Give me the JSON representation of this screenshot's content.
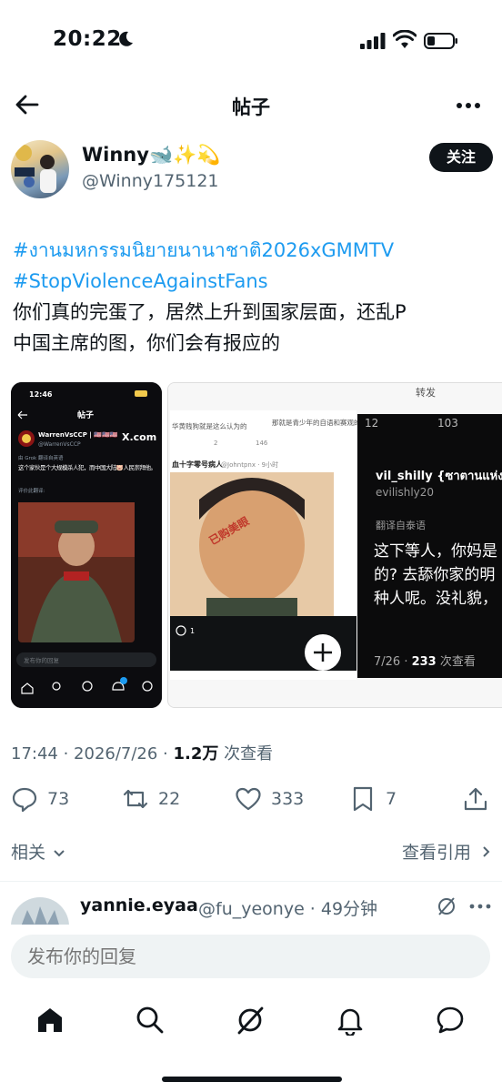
{
  "status_bar": {
    "time": "20:22"
  },
  "header": {
    "title": "帖子"
  },
  "author": {
    "name": "Winny🐋✨💫",
    "handle": "@Winny175121",
    "follow_label": "关注"
  },
  "post": {
    "hashtags": [
      "#งานมหกรรมนิยายนานาชาติ2026xGMMTV",
      "#StopViolenceAgainstFans"
    ],
    "text_lines": [
      "你们真的完蛋了，居然上升到国家层面，还乱P",
      "中国主席的图，你们会有报应的"
    ]
  },
  "media": {
    "left_screenshot": {
      "time": "12:46",
      "title": "帖子",
      "account": "WarrenVsCCP | 🇺🇸🇺🇸🇺🇸",
      "handle": "@WarrenVsCCP",
      "translate_note": "由 Grok 翻译自英语",
      "text": "这个家伙是个大规模杀人犯，而中国大陆🐷人民崇拜他。",
      "rate": "评价此翻译:",
      "reply_placeholder": "发布你的回复",
      "xcom": "X.com"
    },
    "right_screenshot": {
      "top_text": "那就是青少年的自语和赛观的评价",
      "sub_text": "华黄贱狗就是这么认为的",
      "account": "血十字零号病人",
      "handle": "@Johntpnx · 9小时",
      "watermark": "已购美眼",
      "comment_count": "1",
      "repost_label": "转发",
      "repost_count": "103",
      "user": "vil_shilly {ซาตานแห่ง",
      "user_handle": "evilishly20",
      "translate_note": "翻译自泰语",
      "lines": [
        "这下等人，你妈是",
        "的? 去舔你家的明",
        "种人呢。没礼貌，"
      ],
      "views_date": "7/26 · ",
      "views_count": "233",
      "views_suffix": " 次查看",
      "small_counts": [
        "2",
        "146",
        "12"
      ]
    }
  },
  "meta": {
    "timestamp_prefix": "17:44 · 2026/7/26 · ",
    "views": "1.2万",
    "views_suffix": " 次查看"
  },
  "actions": {
    "replies": "73",
    "reposts": "22",
    "likes": "333",
    "bookmarks": "7"
  },
  "related": {
    "label": "相关",
    "quotes": "查看引用"
  },
  "reply_preview": {
    "name": "yannie.eyaa",
    "handle": "@fu_yeonye · 49分钟"
  },
  "composer": {
    "placeholder": "发布你的回复"
  }
}
